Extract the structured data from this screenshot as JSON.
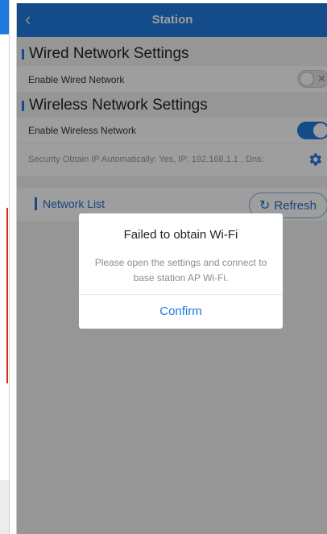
{
  "header": {
    "back_icon": "chevron-left-icon",
    "title": "Station"
  },
  "wired": {
    "section_title": "Wired Network Settings",
    "enable_label": "Enable Wired Network",
    "enabled": false
  },
  "wireless": {
    "section_title": "Wireless Network Settings",
    "enable_label": "Enable Wireless Network",
    "enabled": true,
    "security_info": "Security Obtain IP Automatically:  Yes, IP: 192.168.1.1 , Dns:",
    "settings_icon": "gear-icon"
  },
  "network_list": {
    "label": "Network List",
    "refresh_label": "Refresh",
    "refresh_icon": "refresh-icon"
  },
  "dialog": {
    "title": "Failed to obtain Wi-Fi",
    "message": "Please open the settings and connect to base station AP Wi-Fi.",
    "confirm_label": "Confirm"
  },
  "colors": {
    "accent": "#1f7ae0",
    "overlay": "rgba(0,0,0,0.38)",
    "background": "#f2f2f2"
  }
}
